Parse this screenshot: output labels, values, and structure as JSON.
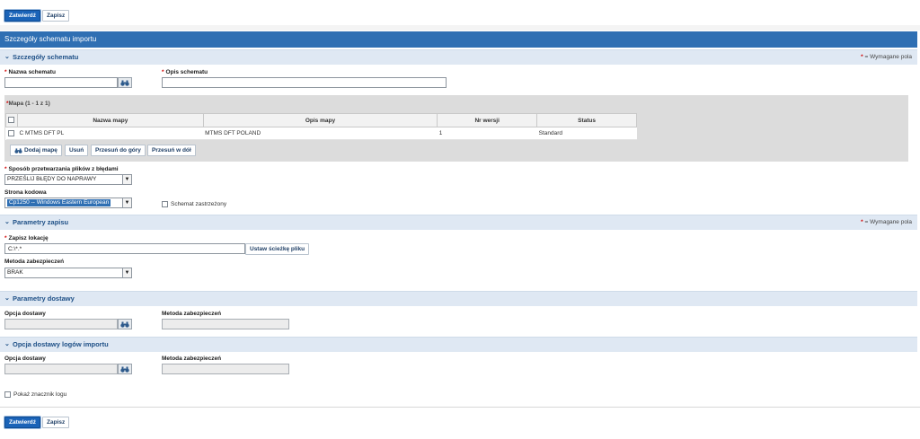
{
  "toolbar": {
    "submit_label": "Zatwierdź",
    "save_label": "Zapisz"
  },
  "page_title": "Szczegóły schematu importu",
  "required_legend": "= Wymagane pola",
  "sections": {
    "schema": {
      "title": "Szczegóły schematu",
      "name_label": "Nazwa schematu",
      "name_value": "",
      "desc_label": "Opis schematu",
      "desc_value": ""
    },
    "maps": {
      "caption": "Mapa (1 - 1 z 1)",
      "columns": [
        "Nazwa mapy",
        "Opis mapy",
        "Nr wersji",
        "Status"
      ],
      "rows": [
        {
          "name": "C MTMS DFT PL",
          "description": "MTMS DFT POLAND",
          "version": "1",
          "status": "Standard"
        }
      ],
      "buttons": {
        "add": "Dodaj mapę",
        "delete": "Usuń",
        "move_up": "Przesuń do góry",
        "move_down": "Przesuń w dół"
      }
    },
    "processing": {
      "method_label": "Sposób przetwarzania plików z błędami",
      "method_value": "PRZEŚLIJ BŁĘDY DO NAPRAWY",
      "codepage_label": "Strona kodowa",
      "codepage_value": "Cp1250 -- Windows Eastern European",
      "locked_label": "Schemat zastrzeżony"
    },
    "save_params": {
      "title": "Parametry zapisu",
      "location_label": "Zapisz lokację",
      "location_value": "C:\\*.*",
      "set_path_label": "Ustaw ścieżkę pliku",
      "security_label": "Metoda zabezpieczeń",
      "security_value": "BRAK"
    },
    "delivery": {
      "title": "Parametry dostawy",
      "option_label": "Opcja dostawy",
      "security_label": "Metoda zabezpieczeń"
    },
    "log_delivery": {
      "title": "Opcja dostawy logów importu",
      "option_label": "Opcja dostawy",
      "security_label": "Metoda zabezpieczeń",
      "show_log_label": "Pokaż znacznik logu"
    }
  },
  "icons": {
    "lookup": "binoculars-icon",
    "collapse": "chevron-down-icon",
    "required": "required-star-icon"
  },
  "colors": {
    "title_bar": "#2f6fb3",
    "section_bar": "#dfe8f3",
    "primary_button": "#1a63b8",
    "required": "#d10000"
  }
}
